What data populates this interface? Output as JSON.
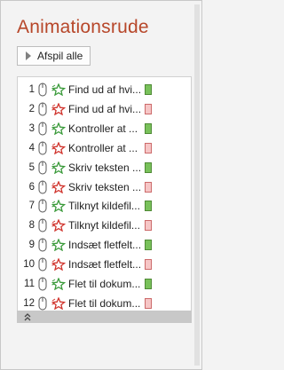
{
  "pane": {
    "title": "Animationsrude",
    "play_label": "Afspil alle"
  },
  "colors": {
    "title": "#b7472a",
    "entry_star": "#3a9a3a",
    "exit_star": "#d0332c",
    "entry_bar": "#79c15b",
    "exit_bar": "#f6c6c6"
  },
  "animations": [
    {
      "num": "1",
      "label": "Find ud af hvi...",
      "effect": "entry"
    },
    {
      "num": "2",
      "label": "Find ud af hvi...",
      "effect": "exit"
    },
    {
      "num": "3",
      "label": "Kontroller at ...",
      "effect": "entry"
    },
    {
      "num": "4",
      "label": "Kontroller at ...",
      "effect": "exit"
    },
    {
      "num": "5",
      "label": "Skriv teksten ...",
      "effect": "entry"
    },
    {
      "num": "6",
      "label": "Skriv teksten ...",
      "effect": "exit"
    },
    {
      "num": "7",
      "label": "Tilknyt kildefil...",
      "effect": "entry"
    },
    {
      "num": "8",
      "label": "Tilknyt kildefil...",
      "effect": "exit"
    },
    {
      "num": "9",
      "label": "Indsæt fletfelt...",
      "effect": "entry"
    },
    {
      "num": "10",
      "label": "Indsæt fletfelt...",
      "effect": "exit"
    },
    {
      "num": "11",
      "label": "Flet til dokum...",
      "effect": "entry"
    },
    {
      "num": "12",
      "label": "Flet til dokum...",
      "effect": "exit"
    }
  ],
  "icons": {
    "play": "play-triangle-icon",
    "trigger": "mouse-click-icon",
    "entry": "green-star-icon",
    "exit": "red-star-icon",
    "collapse": "double-chevron-up-icon"
  }
}
